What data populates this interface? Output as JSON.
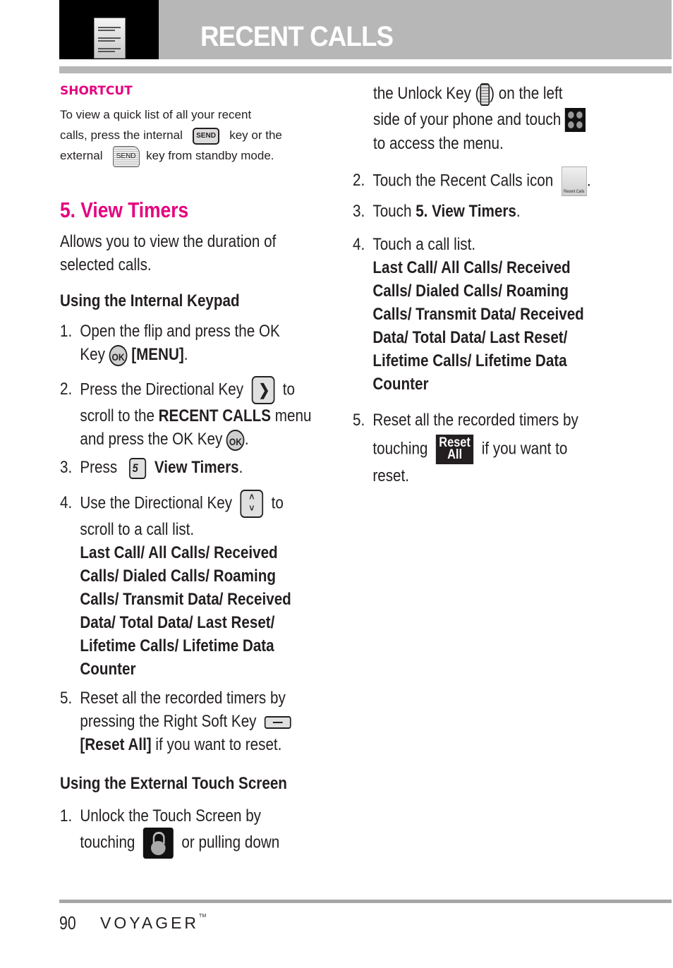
{
  "header": {
    "title": "RECENT CALLS",
    "thumbnail_icon": "recent-calls-thumbnail-icon"
  },
  "shortcut": {
    "heading": "SHORTCUT",
    "line1": "To view a quick list of all your recent",
    "line2_a": "calls, press the internal",
    "line2_b": "key or the",
    "line3_a": "external",
    "line3_b": "key from standby mode.",
    "send_key_label": "SEND"
  },
  "section": {
    "title": "5. View Timers",
    "intro_line1": "Allows you to view the duration of",
    "intro_line2": "selected calls."
  },
  "internal_keypad": {
    "heading": "Using the Internal Keypad",
    "steps": [
      {
        "num": "1.",
        "l1": "Open the flip and press the OK",
        "l2a": "Key",
        "l2b": "[MENU]",
        "l2c": "."
      },
      {
        "num": "2.",
        "l1a": "Press the Directional Key",
        "l1b": "to",
        "l2a": "scroll to the",
        "l2b": "RECENT CALLS",
        "l2c": "menu",
        "l3a": "and press the OK Key",
        "l3b": "."
      },
      {
        "num": "3.",
        "a": "Press",
        "b": "View Timers",
        "c": "."
      },
      {
        "num": "4.",
        "l1a": "Use the Directional Key",
        "l1b": "to",
        "l2": "scroll to a call list.",
        "options": [
          "Last Call/ All Calls/ Received",
          "Calls/ Dialed Calls/ Roaming",
          "Calls/ Transmit Data/ Received",
          "Data/ Total Data/ Last Reset/",
          "Lifetime Calls/ Lifetime Data",
          "Counter"
        ]
      },
      {
        "num": "5.",
        "l1": "Reset all the recorded timers by",
        "l2": "pressing the Right Soft Key",
        "l3a": "[Reset All]",
        "l3b": "if you want to reset."
      }
    ],
    "ok_key_label": "OK",
    "five_key_label": "5"
  },
  "external_touch": {
    "heading": "Using the External Touch Screen",
    "steps": [
      {
        "num": "1.",
        "l1": "Unlock the Touch Screen by",
        "l2a": "touching",
        "l2b": "or pulling down",
        "l3a": "the Unlock Key (",
        "l3b": ") on the left",
        "l4": "side of your phone and touch",
        "l5": "to access the menu."
      },
      {
        "num": "2.",
        "a": "Touch the Recent Calls icon",
        "b": "."
      },
      {
        "num": "3.",
        "a": "Touch",
        "b": "5. View Timers",
        "c": "."
      },
      {
        "num": "4.",
        "l1": "Touch a call list.",
        "options": [
          "Last Call/ All Calls/ Received",
          "Calls/ Dialed Calls/ Roaming",
          "Calls/ Transmit Data/ Received",
          "Data/ Total Data/ Last Reset/",
          "Lifetime Calls/ Lifetime Data",
          "Counter"
        ]
      },
      {
        "num": "5.",
        "l1": "Reset all the recorded timers by",
        "l2a": "touching",
        "l2b": "if you want to",
        "l3": "reset."
      }
    ],
    "recent_calls_icon_caption": "Recent Calls",
    "reset_button_line1": "Reset",
    "reset_button_line2": "All"
  },
  "footer": {
    "page_number": "90",
    "brand": "VOYAGER",
    "trademark": "TM"
  },
  "colors": {
    "accent_magenta": "#e5007e",
    "header_gray": "#b8b7b8",
    "text": "#231f20"
  }
}
